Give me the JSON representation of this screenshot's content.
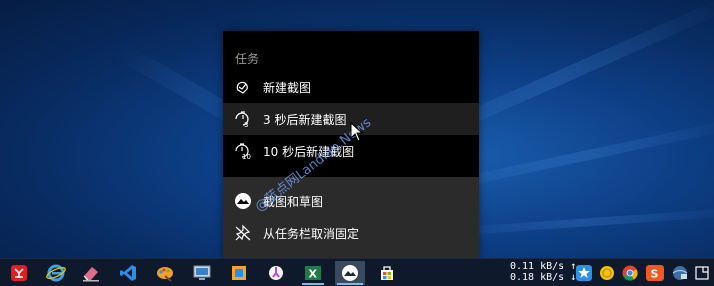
{
  "jumplist": {
    "header": "任务",
    "items": [
      {
        "label": "新建截图",
        "icon": "snip-new-icon"
      },
      {
        "label": "3 秒后新建截图",
        "icon": "timer-3-icon"
      },
      {
        "label": "10 秒后新建截图",
        "icon": "timer-10-icon"
      }
    ],
    "app_items": [
      {
        "label": "截图和草图",
        "icon": "snip-sketch-app-icon"
      },
      {
        "label": "从任务栏取消固定",
        "icon": "unpin-icon"
      }
    ],
    "timer_digits": [
      "3",
      "10"
    ]
  },
  "watermark": "@蓝点网Landian.News",
  "taskbar": {
    "net_up": "0.11 kB/s",
    "net_down": "0.18 kB/s",
    "net_arrow_up": "↑",
    "net_arrow_down": "↓",
    "pinned": [
      "china-unicom-icon",
      "internet-explorer-icon",
      "eraser-app-icon",
      "vscode-icon",
      "paint-icon",
      "remote-desktop-icon",
      "sandbox-icon",
      "tech-app-icon",
      "excel-icon",
      "snip-sketch-icon",
      "store-icon"
    ],
    "tray": [
      "bluetooth-star-icon",
      "coin-icon",
      "chrome-icon",
      "sogou-icon",
      "network-icon",
      "notifications-icon"
    ],
    "excel_letter": "X",
    "sogou_letter": "S"
  },
  "colors": {
    "accent": "#76b9ed",
    "menu_bg": "#000000",
    "menu_lower_bg": "#2b2b2b",
    "hover": "#1f1f1f"
  }
}
